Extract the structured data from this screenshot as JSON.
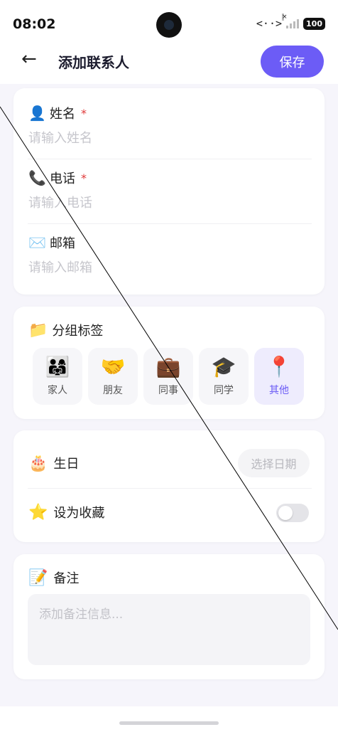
{
  "status_bar": {
    "time": "08:02",
    "network": "<··>",
    "signal_x": "×",
    "battery": "100"
  },
  "header": {
    "title": "添加联系人",
    "save_label": "保存"
  },
  "contact": {
    "name": {
      "icon": "👤",
      "label": "姓名",
      "required_mark": "*",
      "placeholder": "请输入姓名",
      "value": ""
    },
    "phone": {
      "icon": "📞",
      "label": "电话",
      "required_mark": "*",
      "placeholder": "请输入电话",
      "value": ""
    },
    "email": {
      "icon": "✉️",
      "label": "邮箱",
      "placeholder": "请输入邮箱",
      "value": ""
    }
  },
  "groups": {
    "icon": "📁",
    "title": "分组标签",
    "tags": [
      {
        "icon": "👨‍👩‍👧",
        "label": "家人",
        "selected": false
      },
      {
        "icon": "🤝",
        "label": "朋友",
        "selected": false
      },
      {
        "icon": "💼",
        "label": "同事",
        "selected": false
      },
      {
        "icon": "🎓",
        "label": "同学",
        "selected": false
      },
      {
        "icon": "📍",
        "label": "其他",
        "selected": true
      }
    ],
    "accent_color": "#6c5cf6"
  },
  "extra": {
    "birthday": {
      "icon": "🎂",
      "label": "生日",
      "button": "选择日期"
    },
    "favorite": {
      "icon": "⭐",
      "label": "设为收藏",
      "enabled": false
    }
  },
  "notes": {
    "icon": "📝",
    "label": "备注",
    "placeholder": "添加备注信息...",
    "value": ""
  }
}
